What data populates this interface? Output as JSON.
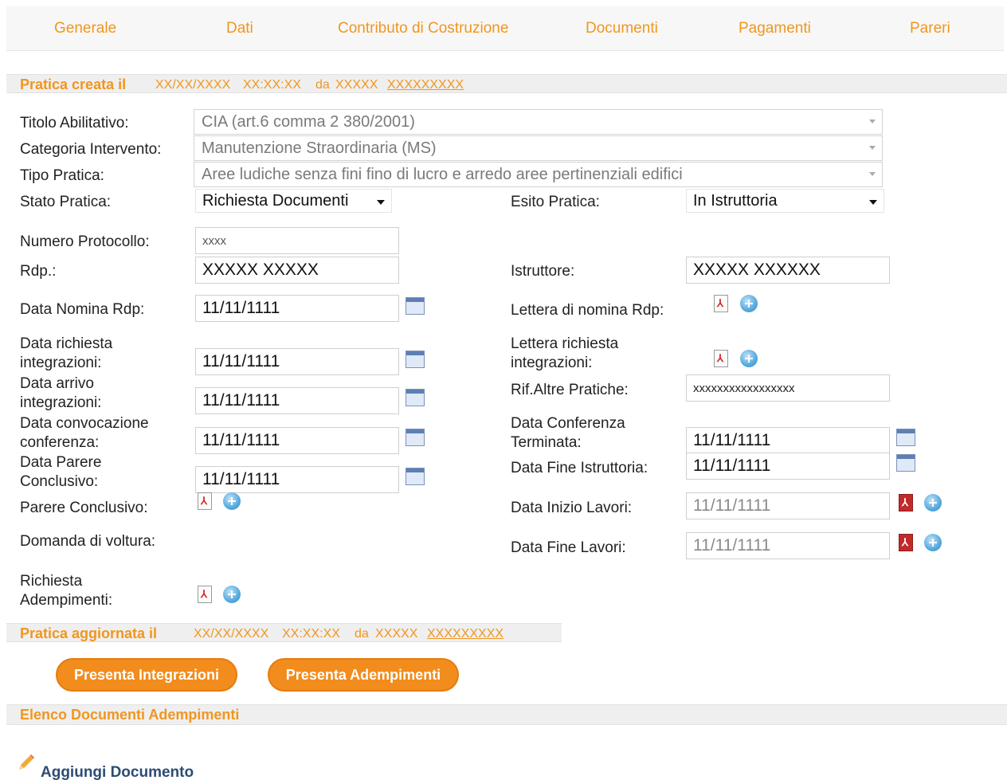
{
  "tabs": [
    "Generale",
    "Dati",
    "Contributo di Costruzione",
    "Documenti",
    "Pagamenti",
    "Pareri"
  ],
  "created": {
    "label": "Pratica creata il",
    "date": "XX/XX/XXXX",
    "time": "XX:XX:XX",
    "by_label": "da",
    "first": "XXXXX",
    "last": "XXXXXXXXX"
  },
  "updated": {
    "label": "Pratica aggiornata il",
    "date": "XX/XX/XXXX",
    "time": "XX:XX:XX",
    "by_label": "da",
    "first": "XXXXX",
    "last": "XXXXXXXXX"
  },
  "form": {
    "titolo_label": "Titolo Abilitativo:",
    "titolo_value": "CIA (art.6 comma 2 380/2001)",
    "categoria_label": "Categoria Intervento:",
    "categoria_value": "Manutenzione Straordinaria (MS)",
    "tipo_label": "Tipo Pratica:",
    "tipo_value": "Aree ludiche senza fini fino di lucro e arredo aree pertinenziali edifici",
    "stato_label": "Stato Pratica:",
    "stato_value": "Richiesta Documenti",
    "esito_label": "Esito Pratica:",
    "esito_value": "In Istruttoria",
    "protocollo_label": "Numero Protocollo:",
    "protocollo_value": "xxxx",
    "rdp_label": "Rdp.:",
    "rdp_value": "XXXXX XXXXX",
    "istruttore_label": "Istruttore:",
    "istruttore_value": "XXXXX XXXXXX",
    "data_nomina_label": "Data Nomina Rdp:",
    "data_nomina_value": "11/11/1111",
    "lettera_nomina_label": "Lettera di nomina Rdp:",
    "data_richiesta_label_1": "Data richiesta",
    "data_richiesta_label_2": "integrazioni:",
    "data_richiesta_value": "11/11/1111",
    "lettera_richiesta_label_1": "Lettera richiesta",
    "lettera_richiesta_label_2": "integrazioni:",
    "data_arrivo_label_1": "Data arrivo",
    "data_arrivo_label_2": "integrazioni:",
    "data_arrivo_value": "11/11/1111",
    "rif_label": "Rif.Altre Pratiche:",
    "rif_value": "xxxxxxxxxxxxxxxxx",
    "data_convocazione_label_1": "Data convocazione",
    "data_convocazione_label_2": "conferenza:",
    "data_convocazione_value": "11/11/1111",
    "data_conferenza_label_1": "Data Conferenza",
    "data_conferenza_label_2": "Terminata:",
    "data_conferenza_value": "11/11/1111",
    "data_parere_label_1": "Data Parere",
    "data_parere_label_2": "Conclusivo:",
    "data_parere_value": "11/11/1111",
    "data_fine_istruttoria_label": "Data Fine Istruttoria:",
    "data_fine_istruttoria_value": "11/11/1111",
    "parere_label": "Parere Conclusivo:",
    "data_inizio_lavori_label": "Data Inizio Lavori:",
    "data_inizio_lavori_value": "11/11/1111",
    "voltura_label": "Domanda di voltura:",
    "data_fine_lavori_label": "Data Fine Lavori:",
    "data_fine_lavori_value": "11/11/1111",
    "richiesta_adempimenti_label_1": "Richiesta",
    "richiesta_adempimenti_label_2": "Adempimenti:"
  },
  "buttons": {
    "integrazioni": "Presenta Integrazioni",
    "adempimenti": "Presenta Adempimenti"
  },
  "documents": {
    "title": "Elenco Documenti Adempimenti",
    "add_label": "Aggiungi Documento"
  },
  "colors": {
    "accent": "#f0961e",
    "button": "#f28c1c",
    "link": "#2d4c73"
  },
  "icons": [
    "calendar-icon",
    "pdf-icon",
    "add-icon",
    "pencil-icon",
    "chevron-down-icon"
  ]
}
